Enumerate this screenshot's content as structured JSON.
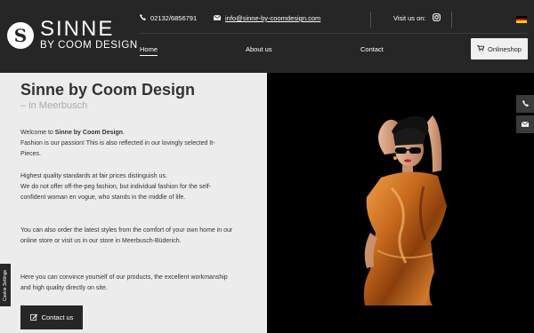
{
  "header": {
    "logo_letter": "S",
    "logo_title": "SINNE",
    "logo_subtitle": "BY COOM DESIGN",
    "phone": "02132/6856791",
    "email": "info@sinne-by-coomdesign.com",
    "social_label": "Visit us on:",
    "language_flag": "German flag",
    "nav": {
      "home": "Home",
      "about": "About us",
      "contact": "Contact"
    },
    "shop_label": "Onlineshop"
  },
  "main": {
    "title": "Sinne by Coom Design",
    "subtitle": "– in Meerbusch",
    "welcome_prefix": "Welcome to ",
    "welcome_brand": "Sinne by Coom Design",
    "welcome_suffix": ".",
    "p1": "Fashion is our passion! This is also reflected in our lovingly selected It-Pieces.",
    "p2": "Highest quality standards at fair prices distinguish us.",
    "p3": "We do not offer off-the-peg fashion, but individual fashion for the self-confident woman en vogue, who stands in the middle of life.",
    "p4": "You can also order the latest styles from the comfort of your own home in our online store or visit us in our store in Meerbusch-Büderich.",
    "p5": "Here you can convince yourself of our products, the excellent workmanship and high quality directly on site.",
    "contact_button": "Contact us"
  },
  "cookie_tab": "Cookie Settings",
  "colors": {
    "header": "#262626",
    "content_bg": "#ececec",
    "accent_text": "#333333"
  },
  "icons": [
    "phone-icon",
    "envelope-icon",
    "instagram-icon",
    "cart-icon",
    "edit-icon"
  ]
}
